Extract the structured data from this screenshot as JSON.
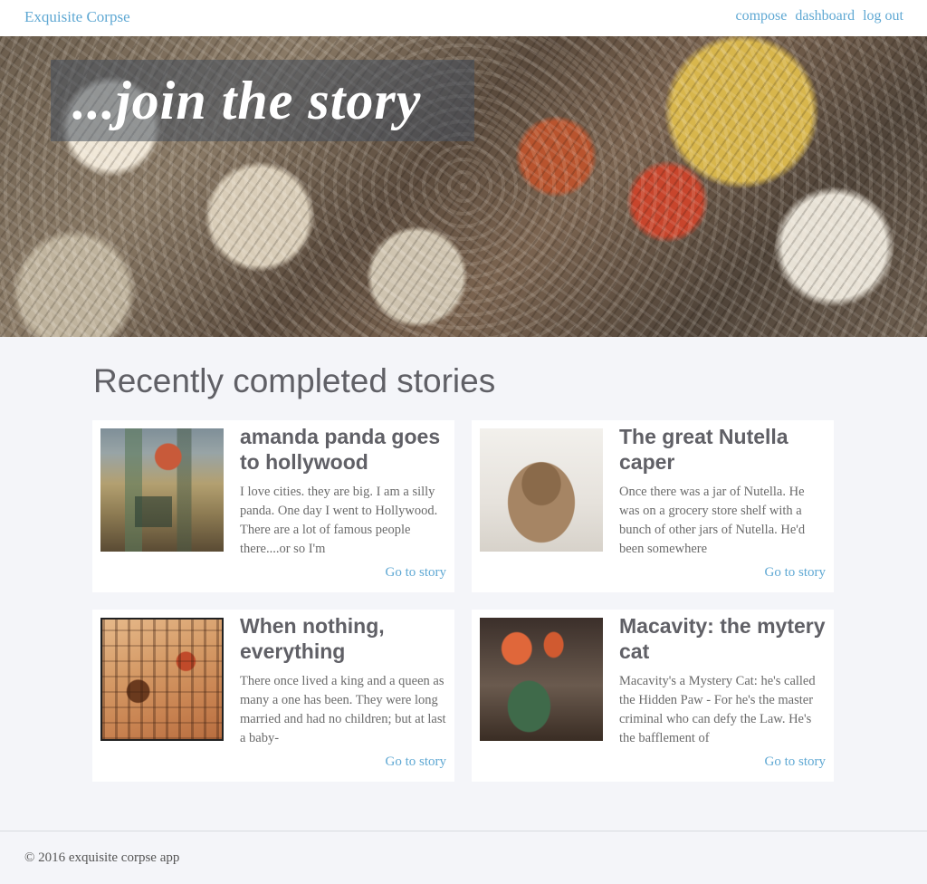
{
  "navbar": {
    "brand": "Exquisite Corpse",
    "links": [
      "compose",
      "dashboard",
      "log out"
    ]
  },
  "hero": {
    "title": "...join the story",
    "image": "surrealist-collage-painting"
  },
  "section": {
    "title": "Recently completed stories"
  },
  "stories": [
    {
      "title": "amanda panda goes to hollywood",
      "excerpt": "I love cities. they are big. I am a silly panda. One day I went to Hollywood. There are a lot of famous people there....or so I'm",
      "link": "Go to story",
      "image": "abstract-red-balloon-painting"
    },
    {
      "title": "The great Nutella caper",
      "excerpt": "Once there was a jar of Nutella. He was on a grocery store shelf with a bunch of other jars of Nutella. He'd been somewhere",
      "link": "Go to story",
      "image": "fur-covered-teacup"
    },
    {
      "title": "When nothing, everything",
      "excerpt": "There once lived a king and a queen as many a one has been. They were long married and had no children; but at last a baby-",
      "link": "Go to story",
      "image": "abstract-warm-toned-painting"
    },
    {
      "title": "Macavity: the mytery cat",
      "excerpt": "Macavity's a Mystery Cat: he's called the Hidden Paw - For he's the master criminal who can defy the Law. He's the bafflement of",
      "link": "Go to story",
      "image": "surreal-bird-of-paradise-painting"
    }
  ],
  "footer": {
    "text": "© 2016 exquisite corpse app"
  },
  "colors": {
    "link": "#5fa8d3",
    "background": "#f4f5f9",
    "card": "#ffffff",
    "heading": "#606066"
  }
}
